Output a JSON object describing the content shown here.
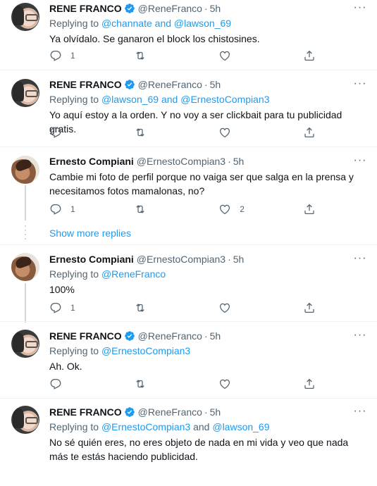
{
  "tweets": [
    {
      "name": "RENE FRANCO",
      "handle": "@ReneFranco",
      "time": "5h",
      "replying_prefix": "Replying to ",
      "replying_a": "@channate",
      "replying_and": " and ",
      "replying_b": "@lawson_69",
      "text": "Ya olvídalo. Se ganaron el block los chistosines.",
      "reply_count": "1",
      "retweet_count": "",
      "like_count": ""
    },
    {
      "name": "RENE FRANCO",
      "handle": "@ReneFranco",
      "time": "5h",
      "replying_prefix": "Replying to ",
      "replying_a": "@lawson_69",
      "replying_and": " and ",
      "replying_b": "@ErnestoCompian3",
      "text": "Yo aquí estoy a la orden. Y no voy a ser clickbait para tu publicidad gratis.",
      "reply_count": "",
      "retweet_count": "",
      "like_count": ""
    },
    {
      "name": "Ernesto Compiani",
      "handle": "@ErnestoCompian3",
      "time": "5h",
      "text": "Cambie mi foto de perfil porque no vaiga ser que salga en la prensa y necesitamos fotos mamalonas, no?",
      "reply_count": "1",
      "retweet_count": "",
      "like_count": "2"
    },
    {
      "name": "Ernesto Compiani",
      "handle": "@ErnestoCompian3",
      "time": "5h",
      "replying_prefix": "Replying to ",
      "replying_a": "@ReneFranco",
      "text": "100%",
      "reply_count": "1",
      "retweet_count": "",
      "like_count": ""
    },
    {
      "name": "RENE FRANCO",
      "handle": "@ReneFranco",
      "time": "5h",
      "replying_prefix": "Replying to ",
      "replying_a": "@ErnestoCompian3",
      "text": "Ah. Ok.",
      "reply_count": "",
      "retweet_count": "",
      "like_count": ""
    },
    {
      "name": "RENE FRANCO",
      "handle": "@ReneFranco",
      "time": "5h",
      "replying_prefix": "Replying to ",
      "replying_a": "@ErnestoCompian3",
      "replying_and": " and ",
      "replying_b": "@lawson_69",
      "text": "No sé quién eres, no eres objeto de nada en mi vida y veo que nada más te estás haciendo publicidad.",
      "reply_count": "",
      "retweet_count": "",
      "like_count": ""
    }
  ],
  "show_more_replies": "Show more replies",
  "dot": "·",
  "icons": [
    "verified-badge-icon",
    "more-options-icon",
    "reply-icon",
    "retweet-icon",
    "like-icon",
    "share-icon"
  ],
  "colors": {
    "accent": "#1d9bf0",
    "secondary_text": "#536471",
    "text": "#0f1419",
    "divider": "#eff3f4"
  }
}
